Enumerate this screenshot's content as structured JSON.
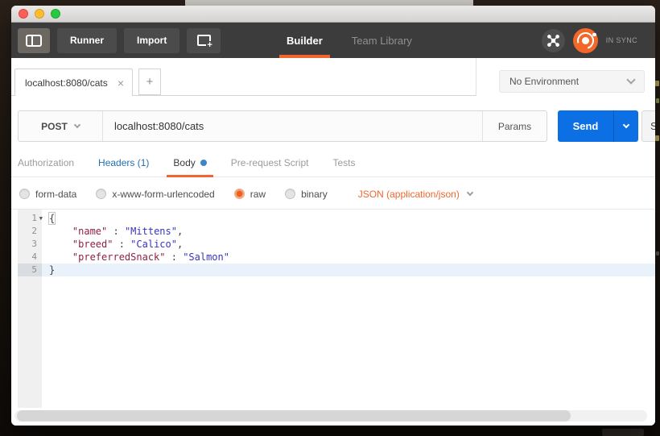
{
  "colors": {
    "accent_orange": "#f0662c",
    "send_blue": "#0c6fe3",
    "link_blue": "#2470b3",
    "body_dot_blue": "#3d85c6",
    "code_key": "#8e2045",
    "code_string": "#3634c0"
  },
  "toolbar": {
    "runner_label": "Runner",
    "import_label": "Import",
    "nav_tabs": [
      {
        "label": "Builder",
        "active": true
      },
      {
        "label": "Team Library",
        "active": false
      }
    ],
    "sync_status": "IN SYNC"
  },
  "tab_bar": {
    "active_tab_title": "localhost:8080/cats",
    "close_glyph": "×",
    "new_tab_glyph": "+",
    "environment_selected": "No Environment"
  },
  "request_bar": {
    "method": "POST",
    "url": "localhost:8080/cats",
    "params_label": "Params",
    "send_label": "Send",
    "save_label_visible": "S"
  },
  "request_tabs": [
    {
      "label": "Authorization",
      "style": "muted"
    },
    {
      "label": "Headers (1)",
      "style": "link"
    },
    {
      "label": "Body",
      "style": "active",
      "dot": true
    },
    {
      "label": "Pre-request Script",
      "style": "muted"
    },
    {
      "label": "Tests",
      "style": "muted"
    }
  ],
  "body_panel": {
    "modes": [
      {
        "label": "form-data",
        "selected": false
      },
      {
        "label": "x-www-form-urlencoded",
        "selected": false
      },
      {
        "label": "raw",
        "selected": true
      },
      {
        "label": "binary",
        "selected": false
      }
    ],
    "content_type": "JSON (application/json)"
  },
  "editor": {
    "lines": [
      {
        "num": "1",
        "fold": true,
        "tokens": [
          {
            "cls": "punct match",
            "text": "{"
          }
        ]
      },
      {
        "num": "2",
        "tokens": [
          {
            "cls": "punct",
            "text": "    "
          },
          {
            "cls": "key",
            "text": "\"name\""
          },
          {
            "cls": "punct",
            "text": " : "
          },
          {
            "cls": "str",
            "text": "\"Mittens\""
          },
          {
            "cls": "punct",
            "text": ","
          }
        ]
      },
      {
        "num": "3",
        "tokens": [
          {
            "cls": "punct",
            "text": "    "
          },
          {
            "cls": "key",
            "text": "\"breed\""
          },
          {
            "cls": "punct",
            "text": " : "
          },
          {
            "cls": "str",
            "text": "\"Calico\""
          },
          {
            "cls": "punct",
            "text": ","
          }
        ]
      },
      {
        "num": "4",
        "tokens": [
          {
            "cls": "punct",
            "text": "    "
          },
          {
            "cls": "key",
            "text": "\"preferredSnack\""
          },
          {
            "cls": "punct",
            "text": " : "
          },
          {
            "cls": "str",
            "text": "\"Salmon\""
          }
        ]
      },
      {
        "num": "5",
        "active": true,
        "tokens": [
          {
            "cls": "punct",
            "text": "}"
          }
        ]
      }
    ]
  }
}
